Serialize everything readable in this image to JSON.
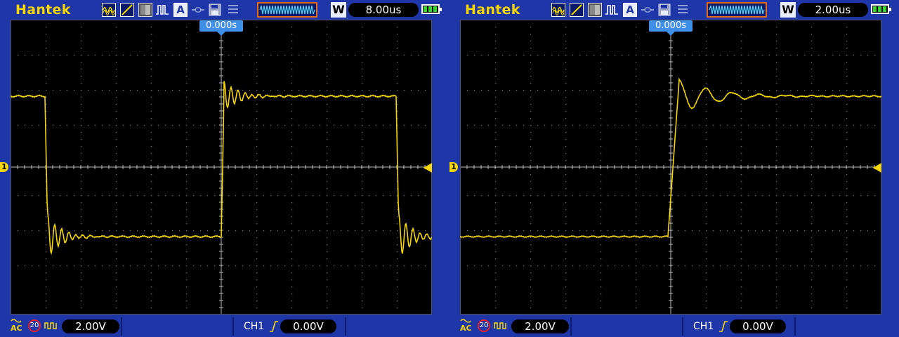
{
  "scopes": [
    {
      "brand": "Hantek",
      "timebase": "8.00us",
      "trigger_position": "0.000s",
      "channel_marker": "1",
      "bandwidth_limit": "20",
      "coupling": "AC",
      "volts_per_div": "2.00V",
      "trigger_source": "CH1",
      "trigger_level": "0.00V",
      "icons": [
        "waveform-icon",
        "line-icon",
        "grayscale-icon",
        "pulse-icon",
        "auto-icon",
        "link-icon",
        "save-icon",
        "menu-icon",
        "trace-preview-icon",
        "w-icon",
        "battery-icon"
      ]
    },
    {
      "brand": "Hantek",
      "timebase": "2.00us",
      "trigger_position": "0.000s",
      "channel_marker": "1",
      "bandwidth_limit": "20",
      "coupling": "AC",
      "volts_per_div": "2.00V",
      "trigger_source": "CH1",
      "trigger_level": "0.00V",
      "icons": [
        "waveform-icon",
        "line-icon",
        "grayscale-icon",
        "pulse-icon",
        "auto-icon",
        "link-icon",
        "save-icon",
        "menu-icon",
        "trace-preview-icon",
        "w-icon",
        "battery-icon"
      ]
    }
  ],
  "colors": {
    "frame": "#1f36a8",
    "trace": "#f6d800",
    "grid_bg": "#000000",
    "grid_dots": "#7a7a7a",
    "trigger_label": "#3f8fe8",
    "battery": "#36d72c",
    "bandwidth_ring": "#e0202e"
  }
}
